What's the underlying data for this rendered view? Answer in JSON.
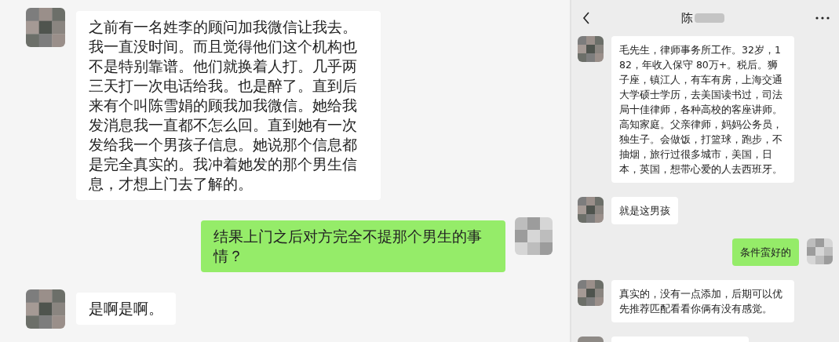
{
  "left_chat": {
    "messages": [
      {
        "kind": "received",
        "text": "之前有一名姓李的顾问加我微信让我去。我一直没时间。而且觉得他们这个机构也不是特别靠谱。他们就换着人打。几乎两三天打一次电话给我。也是醉了。直到后来有个叫陈雪娟的顾我加我微信。她给我发消息我一直都不怎么回。直到她有一次发给我一个男孩子信息。她说那个信息都是完全真实的。我冲着她发的那个男生信息，才想上门去了解的。"
      },
      {
        "kind": "sent",
        "text": "结果上门之后对方完全不提那个男生的事情？"
      },
      {
        "kind": "received",
        "text": "是啊是啊。"
      }
    ]
  },
  "right_chat": {
    "header": {
      "title": "陈"
    },
    "messages": [
      {
        "kind": "received",
        "text": "毛先生，律师事务所工作。32岁，182，年收入保守 80万+。税后。狮子座，镇江人，有车有房，上海交通大学硕士学历，去美国读书过，司法局十佳律师，各种高校的客座讲师。高知家庭。父亲律师，妈妈公务员，独生子。会做饭，打篮球，跑步，不抽烟，旅行过很多城市，美国，日本，英国，想带心爱的人去西班牙。"
      },
      {
        "kind": "received",
        "text": "就是这男孩"
      },
      {
        "kind": "sent",
        "text": "条件蛮好的"
      },
      {
        "kind": "received",
        "text": "真实的，没有一点添加，后期可以优先推荐匹配看看你俩有没有感觉。"
      }
    ]
  }
}
